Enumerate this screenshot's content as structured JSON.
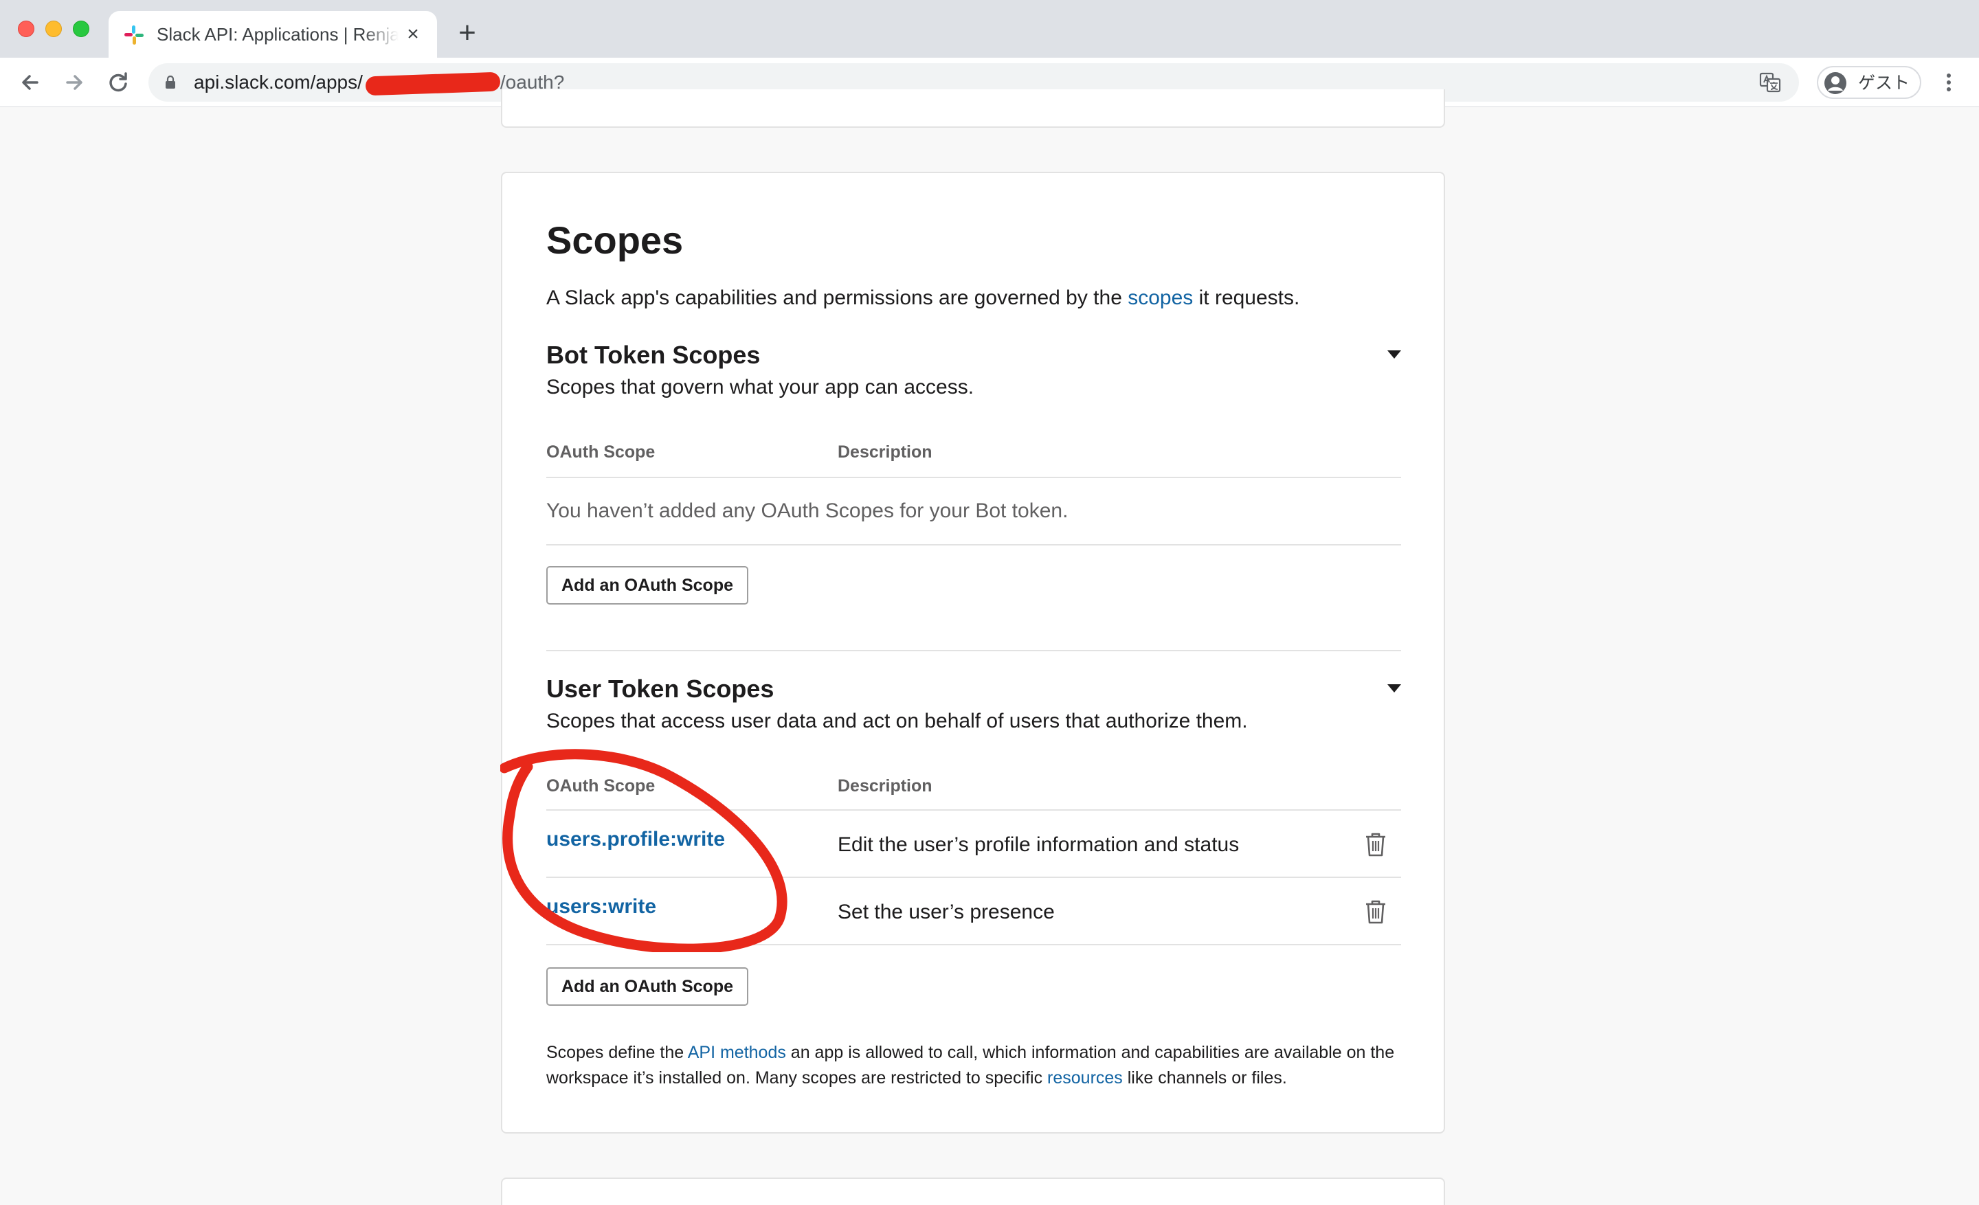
{
  "browser": {
    "tab_title": "Slack API: Applications | Renjal",
    "tab_close": "×",
    "new_tab": "+",
    "url_host": "api.slack.com/apps/",
    "url_path": "/oauth?",
    "profile_label": "ゲスト",
    "icons": [
      "slack-icon",
      "back-arrow-icon",
      "forward-arrow-icon",
      "reload-icon",
      "lock-icon",
      "translate-icon",
      "avatar-icon",
      "more-menu-icon"
    ]
  },
  "scopes": {
    "title": "Scopes",
    "intro_before": "A Slack app's capabilities and permissions are governed by the ",
    "intro_link": "scopes",
    "intro_after": " it requests.",
    "table_headers": {
      "scope": "OAuth Scope",
      "description": "Description"
    },
    "bot": {
      "title": "Bot Token Scopes",
      "description": "Scopes that govern what your app can access.",
      "empty_message": "You haven’t added any OAuth Scopes for your Bot token.",
      "add_button": "Add an OAuth Scope"
    },
    "user": {
      "title": "User Token Scopes",
      "description": "Scopes that access user data and act on behalf of users that authorize them.",
      "rows": [
        {
          "scope": "users.profile:write",
          "description": "Edit the user’s profile information and status"
        },
        {
          "scope": "users:write",
          "description": "Set the user’s presence"
        }
      ],
      "add_button": "Add an OAuth Scope"
    },
    "footnote": {
      "part1": "Scopes define the ",
      "link1": "API methods",
      "part2": " an app is allowed to call, which information and capabilities are available on the workspace it’s installed on. Many scopes are restricted to specific ",
      "link2": "resources",
      "part3": " like channels or files."
    }
  },
  "colors": {
    "link": "#1264a3",
    "annotation": "#e8281a",
    "text": "#1d1c1d",
    "muted": "#616061"
  }
}
